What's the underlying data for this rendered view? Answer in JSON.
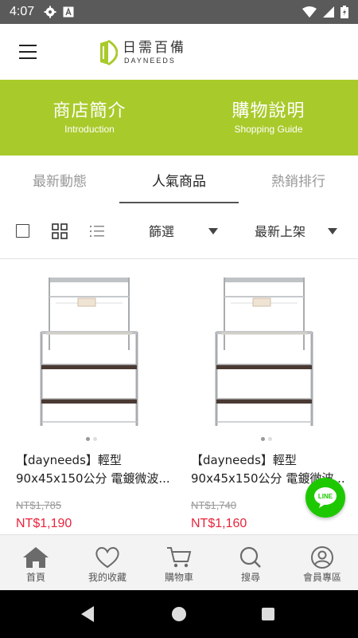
{
  "status_bar": {
    "time": "4:07"
  },
  "header": {
    "logo_cn": "日需百備",
    "logo_en": "DAYNEEDS"
  },
  "banner": [
    {
      "cn": "商店簡介",
      "en": "Introduction"
    },
    {
      "cn": "購物說明",
      "en": "Shopping Guide"
    }
  ],
  "tabs": [
    {
      "label": "最新動態"
    },
    {
      "label": "人氣商品",
      "active": true
    },
    {
      "label": "熱銷排行"
    }
  ],
  "toolbar": {
    "filter_label": "篩選",
    "sort_label": "最新上架"
  },
  "products": [
    {
      "title_line1": "【dayneeds】輕型",
      "title_line2": "90x45x150公分 電鍍微波...",
      "original_price": "NT$1,785",
      "sale_price": "NT$1,190"
    },
    {
      "title_line1": "【dayneeds】輕型",
      "title_line2": "90x45x150公分 電鍍微波...",
      "original_price": "NT$1,740",
      "sale_price": "NT$1,160"
    }
  ],
  "line_button": {
    "label": "LINE"
  },
  "bottom_nav": [
    {
      "label": "首頁",
      "icon": "home-icon"
    },
    {
      "label": "我的收藏",
      "icon": "heart-icon"
    },
    {
      "label": "購物車",
      "icon": "cart-icon"
    },
    {
      "label": "搜尋",
      "icon": "search-icon"
    },
    {
      "label": "會員專區",
      "icon": "user-icon"
    }
  ],
  "colors": {
    "accent_green": "#a9ca2b",
    "price_red": "#e8243c",
    "line_green": "#1ec800"
  }
}
